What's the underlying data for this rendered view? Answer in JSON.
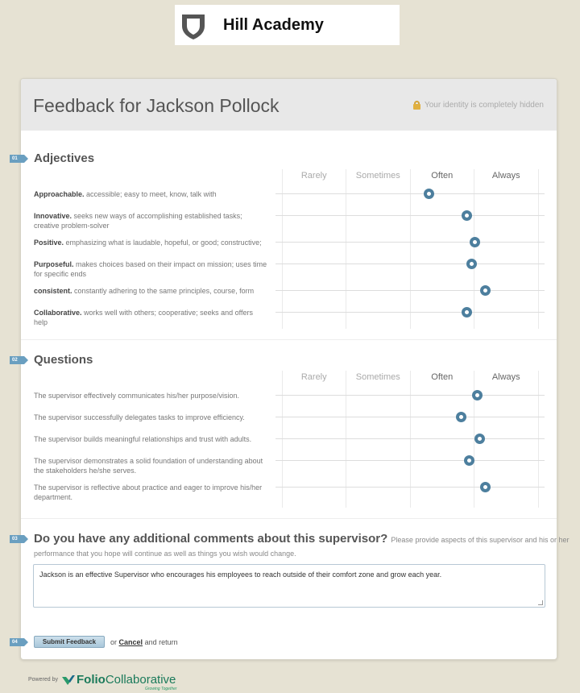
{
  "header": {
    "brand": "Hill Academy"
  },
  "page": {
    "title": "Feedback for Jackson Pollock",
    "identity_note": "Your identity is completely hidden"
  },
  "scale": [
    "Rarely",
    "Sometimes",
    "Often",
    "Always"
  ],
  "sections": {
    "adjectives": {
      "step": "01",
      "title": "Adjectives",
      "rows": [
        {
          "term": "Approachable.",
          "desc": "accessible; easy to meet, know, talk with",
          "rating": 0.57
        },
        {
          "term": "Innovative.",
          "desc": "seeks new ways of accomplishing established tasks; creative problem-solver",
          "rating": 0.71
        },
        {
          "term": "Positive.",
          "desc": "emphasizing what is laudable, hopeful, or good; constructive;",
          "rating": 0.74
        },
        {
          "term": "Purposeful.",
          "desc": "makes choices based on their impact on mission; uses time for specific ends",
          "rating": 0.73
        },
        {
          "term": "consistent.",
          "desc": "constantly adhering to the same principles, course, form",
          "rating": 0.78
        },
        {
          "term": "Collaborative.",
          "desc": "works well with others; cooperative; seeks and offers help",
          "rating": 0.71
        }
      ]
    },
    "questions": {
      "step": "02",
      "title": "Questions",
      "rows": [
        {
          "text": "The supervisor effectively communicates his/her purpose/vision.",
          "rating": 0.75
        },
        {
          "text": "The supervisor successfully delegates tasks to improve efficiency.",
          "rating": 0.69
        },
        {
          "text": "The supervisor builds meaningful relationships and trust with adults.",
          "rating": 0.76
        },
        {
          "text": "The supervisor demonstrates a solid foundation of understanding about the stakeholders he/she serves.",
          "rating": 0.72
        },
        {
          "text": "The supervisor is reflective about practice and eager to improve his/her department.",
          "rating": 0.78
        }
      ]
    },
    "comments": {
      "step": "03",
      "title": "Do you have any additional comments about this supervisor?",
      "hint_a": "Please provide aspects of this supervisor and his or her",
      "hint_b": "performance that you hope will continue as well as things you wish would change.",
      "value": "Jackson is an effective Supervisor who encourages his employees to reach outside of their comfort zone and grow each year."
    },
    "submit": {
      "step": "04",
      "button_label": "Submit Feedback",
      "or_text": "or",
      "cancel_label": "Cancel",
      "return_text": "and return"
    }
  },
  "footer": {
    "powered_by": "Powered by",
    "folio_a": "Folio",
    "folio_b": "Collaborative",
    "tagline": "Growing Together"
  },
  "colors": {
    "accent": "#4d7f9e",
    "step_badge": "#6a9fc0",
    "background": "#e6e2d3",
    "folio_green": "#1a7a5a"
  },
  "icons": {
    "logo": "shield-icon",
    "lock": "lock-icon",
    "folio": "folio-check-icon"
  }
}
